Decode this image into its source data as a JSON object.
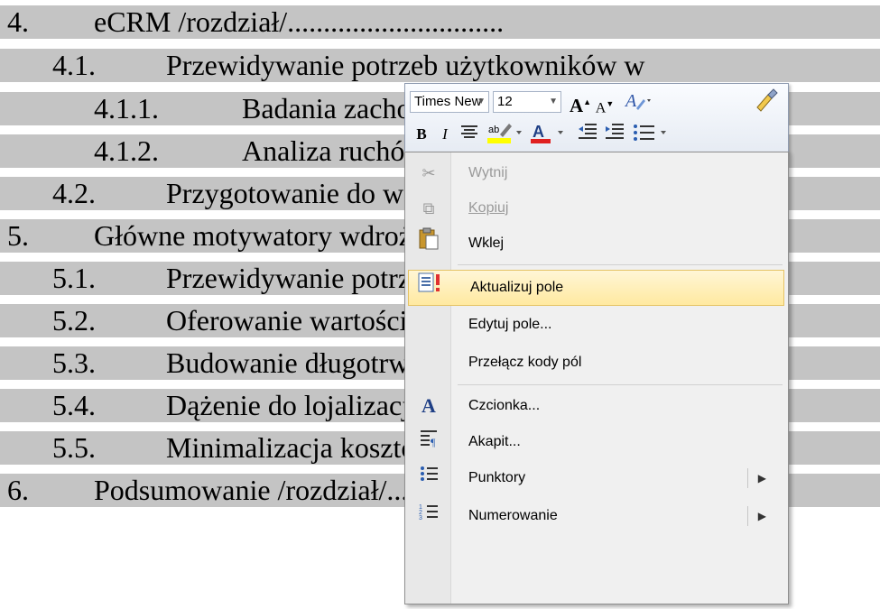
{
  "document": {
    "lines": [
      {
        "num": "4.",
        "text": "eCRM /rozdział/.............................."
      },
      {
        "num": "4.1.",
        "text": "Przewidywanie potrzeb użytkowników w"
      },
      {
        "num": "4.1.1.",
        "text": "Badania zachowań internautów ich? /"
      },
      {
        "num": "4.1.2.",
        "text": "Analiza ruchów użytkownika po stroi"
      },
      {
        "num": "4.2.",
        "text": "Przygotowanie do wdrożenia systemu eCI"
      },
      {
        "num": "5.",
        "text": "Główne motywatory wdrożenia systemu CRM"
      },
      {
        "num": "5.1.",
        "text": "Przewidywanie potrzeb klientów we wdrożo"
      },
      {
        "num": "5.2.",
        "text": "Oferowanie wartości dodanej /rozdzia"
      },
      {
        "num": "5.3.",
        "text": "Budowanie długotrwałych relacji z klienta"
      },
      {
        "num": "5.4.",
        "text": "Dążenie do lojalizacji klientów /rozdział"
      },
      {
        "num": "5.5.",
        "text": "Minimalizacja kosztów obsługi sprzedażowy"
      },
      {
        "num": "6.",
        "text": "Podsumowanie /rozdział/................................"
      }
    ]
  },
  "mini_toolbar": {
    "font_name": "Times New",
    "font_size": "12",
    "grow_font": "A",
    "shrink_font": "A",
    "bold": "B",
    "italic": "I",
    "underline_color_label": "A"
  },
  "context_menu": {
    "items": [
      {
        "label": "Wytnij",
        "icon": "cut-icon",
        "disabled": true
      },
      {
        "label": "Kopiuj",
        "icon": "copy-icon",
        "disabled": true
      },
      {
        "label": "Wklej",
        "icon": "paste-icon",
        "disabled": false
      },
      {
        "label": "Aktualizuj pole",
        "icon": "update-field-icon",
        "disabled": false,
        "highlighted": true
      },
      {
        "label": "Edytuj pole...",
        "icon": "",
        "disabled": false
      },
      {
        "label": "Przełącz kody pól",
        "icon": "",
        "disabled": false
      },
      {
        "label": "Czcionka...",
        "icon": "font-icon",
        "disabled": false
      },
      {
        "label": "Akapit...",
        "icon": "paragraph-icon",
        "disabled": false
      },
      {
        "label": "Punktory",
        "icon": "bullets-icon",
        "disabled": false,
        "submenu": true
      },
      {
        "label": "Numerowanie",
        "icon": "numbering-icon",
        "disabled": false,
        "submenu": true
      }
    ]
  },
  "colors": {
    "selection": "#c4c4c4",
    "menu_highlight": "#ffe9a0",
    "highlight_yellow": "#ffff00",
    "font_color_red": "#e02020"
  }
}
